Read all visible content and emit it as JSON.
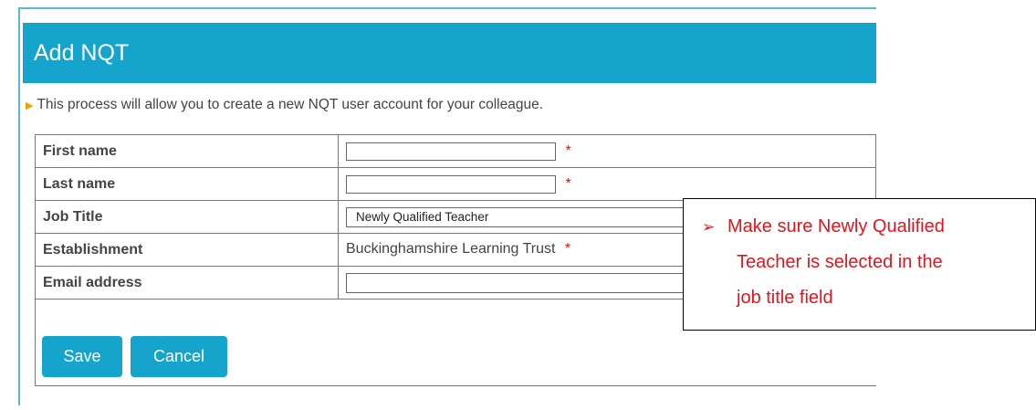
{
  "header": {
    "title": "Add NQT"
  },
  "intro": {
    "text": "This process will allow you to create a new NQT user account for your colleague."
  },
  "form": {
    "first_name_label": "First name",
    "first_name_value": "",
    "last_name_label": "Last name",
    "last_name_value": "",
    "job_title_label": "Job Title",
    "job_title_value": "Newly Qualified Teacher",
    "establishment_label": "Establishment",
    "establishment_value": "Buckinghamshire Learning Trust",
    "email_label": "Email address",
    "email_value": "",
    "required_marker": "*"
  },
  "buttons": {
    "save": "Save",
    "cancel": "Cancel"
  },
  "callout": {
    "line1": "Make sure Newly Qualified",
    "line2": "Teacher is selected in the",
    "line3": "job title field",
    "bullet_icon": "arrow-bullet"
  },
  "colors": {
    "accent": "#15a5cc",
    "callout_text": "#e3141b",
    "required": "#e01010"
  }
}
